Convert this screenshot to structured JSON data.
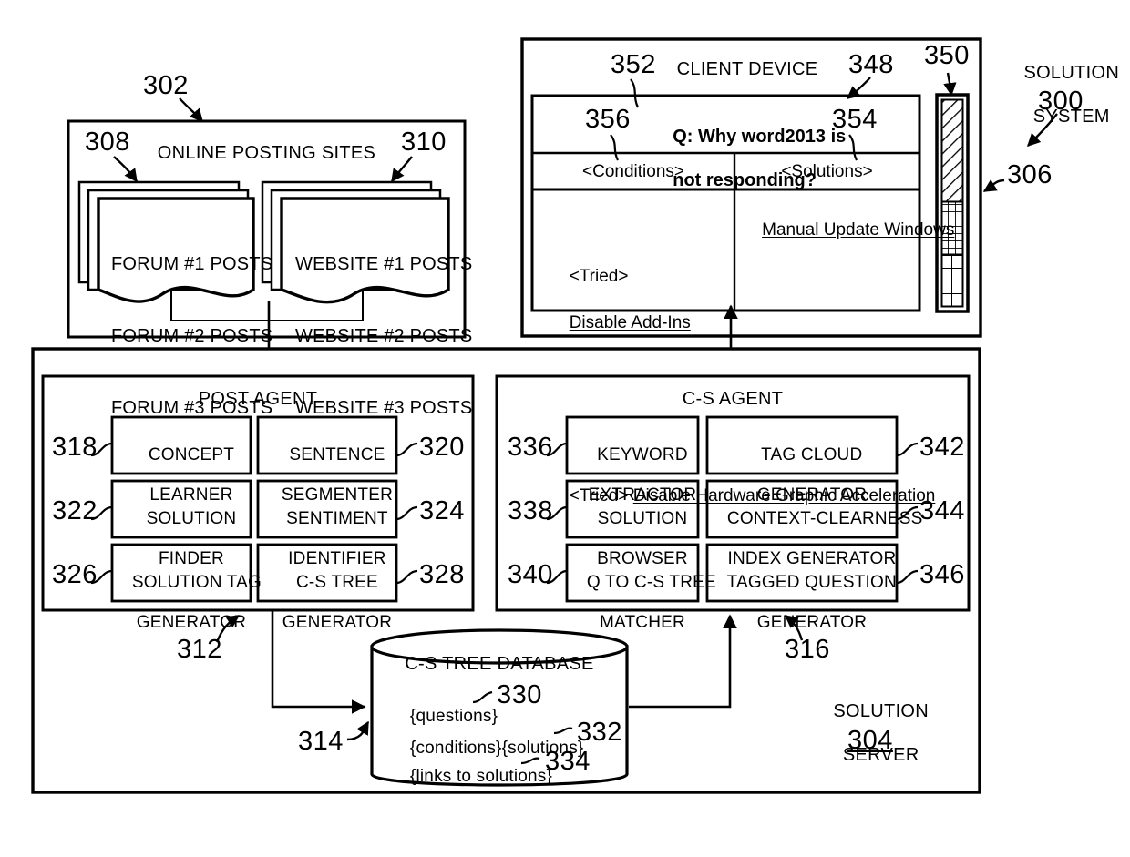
{
  "figure": {
    "system_label": {
      "line1": "SOLUTION",
      "line2": "SYSTEM",
      "ref": "300"
    },
    "refs": {
      "r300": "300",
      "r302": "302",
      "r304": "304",
      "r306": "306",
      "r308": "308",
      "r310": "310",
      "r312": "312",
      "r314": "314",
      "r316": "316",
      "r318": "318",
      "r320": "320",
      "r322": "322",
      "r324": "324",
      "r326": "326",
      "r328": "328",
      "r330": "330",
      "r332": "332",
      "r334": "334",
      "r336": "336",
      "r338": "338",
      "r340": "340",
      "r342": "342",
      "r344": "344",
      "r346": "346",
      "r348": "348",
      "r350": "350",
      "r352": "352",
      "r354": "354",
      "r356": "356"
    }
  },
  "online_posting_sites": {
    "title": "ONLINE POSTING SITES",
    "forum_stack": {
      "ref": "308",
      "lines": [
        "FORUM #1 POSTS",
        "FORUM #2 POSTS",
        "FORUM #3 POSTS"
      ]
    },
    "website_stack": {
      "ref": "310",
      "lines": [
        "WEBSITE #1 POSTS",
        "WEBSITE #2 POSTS",
        "WEBSITE #3 POSTS"
      ]
    }
  },
  "client_device": {
    "title": "CLIENT DEVICE",
    "question": {
      "line1": "Q: Why word2013 is",
      "line2": "not responding?"
    },
    "columns": {
      "conditions": "<Conditions>",
      "solutions": "<Solutions>"
    },
    "conditions_cell": [
      {
        "prefix": "<Tried>",
        "link": "Disable Add-Ins",
        "layout": "stacked"
      },
      {
        "prefix": "<Tried> ",
        "link": "Disable Hardware Graphic Acceleration",
        "layout": "inline"
      }
    ],
    "solutions_cell": [
      {
        "link": "Manual Update Windows"
      }
    ],
    "display_bar_ref": "350"
  },
  "solution_server": {
    "name_line1": "SOLUTION",
    "name_line2": "SERVER",
    "ref": "304",
    "post_agent": {
      "title": "POST AGENT",
      "ref": "312",
      "modules": [
        {
          "ref": "318",
          "line1": "CONCEPT",
          "line2": "LEARNER",
          "side": "left"
        },
        {
          "ref": "320",
          "line1": "SENTENCE",
          "line2": "SEGMENTER",
          "side": "right"
        },
        {
          "ref": "322",
          "line1": "SOLUTION",
          "line2": "FINDER",
          "side": "left"
        },
        {
          "ref": "324",
          "line1": "SENTIMENT",
          "line2": "IDENTIFIER",
          "side": "right"
        },
        {
          "ref": "326",
          "line1": "SOLUTION TAG",
          "line2": "GENERATOR",
          "side": "left"
        },
        {
          "ref": "328",
          "line1": "C-S TREE",
          "line2": "GENERATOR",
          "side": "right"
        }
      ]
    },
    "cs_agent": {
      "title": "C-S AGENT",
      "ref": "316",
      "modules": [
        {
          "ref": "336",
          "line1": "KEYWORD",
          "line2": "EXTRACTOR",
          "side": "left"
        },
        {
          "ref": "342",
          "line1": "TAG CLOUD",
          "line2": "GENERATOR",
          "side": "right"
        },
        {
          "ref": "338",
          "line1": "SOLUTION",
          "line2": "BROWSER",
          "side": "left"
        },
        {
          "ref": "344",
          "line1": "CONTEXT-CLEARNESS",
          "line2": "INDEX GENERATOR",
          "side": "right"
        },
        {
          "ref": "340",
          "line1": "Q TO C-S TREE",
          "line2": "MATCHER",
          "side": "left"
        },
        {
          "ref": "346",
          "line1": "TAGGED QUESTION",
          "line2": "GENERATOR",
          "side": "right"
        }
      ]
    },
    "database": {
      "title": "C-S TREE DATABASE",
      "ref": "314",
      "entries": [
        {
          "text": "{questions}",
          "ref": "330"
        },
        {
          "text": "{conditions}{solutions}",
          "ref": "332"
        },
        {
          "text": "{links to solutions}",
          "ref": "334"
        }
      ]
    }
  }
}
